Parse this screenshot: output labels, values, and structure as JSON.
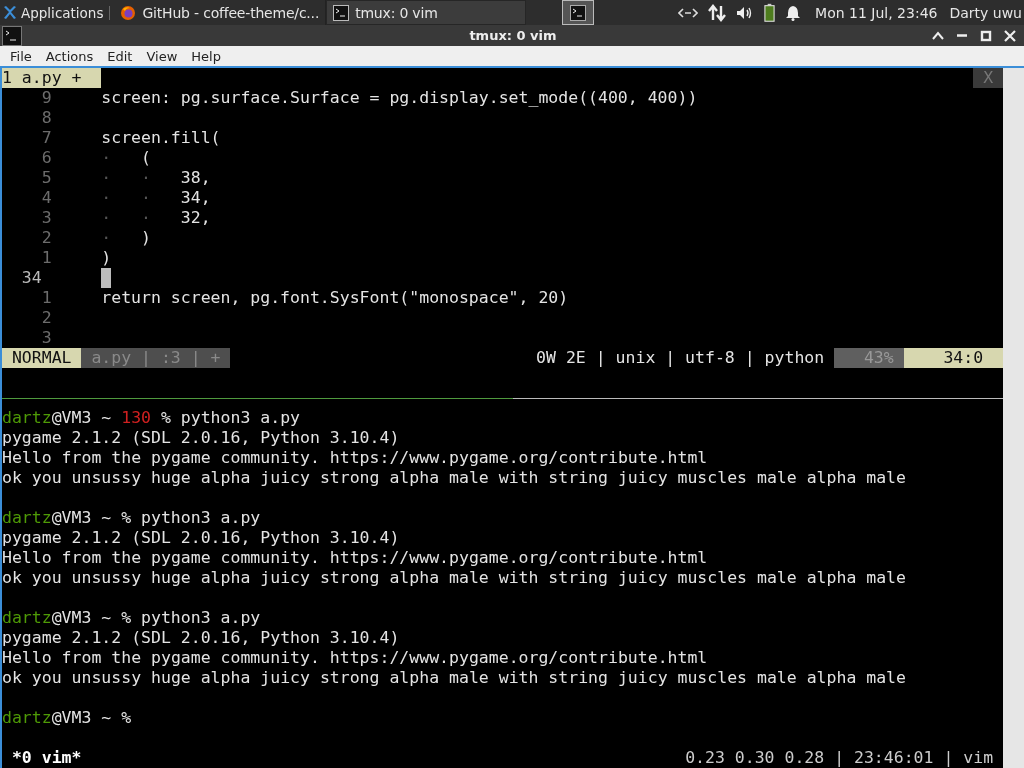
{
  "top_panel": {
    "apps_menu": "Applications",
    "tasks": [
      {
        "label": "GitHub - coffee-theme/c...",
        "kind": "browser",
        "selected": false
      },
      {
        "label": "tmux: 0 vim",
        "kind": "terminal",
        "selected": true
      }
    ],
    "clock": "Mon 11 Jul, 23:46",
    "user": "Darty uwu"
  },
  "window": {
    "title": "tmux: 0 vim",
    "menu": [
      "File",
      "Actions",
      "Edit",
      "View",
      "Help"
    ]
  },
  "vim": {
    "tab": "1 a.py +",
    "close": "X",
    "lines": [
      {
        "number": "9",
        "current": false,
        "code": "screen: pg.surface.Surface = pg.display.set_mode((400, 400))"
      },
      {
        "number": "8",
        "current": false
      },
      {
        "number": "7",
        "current": false,
        "code": "screen.fill("
      },
      {
        "number": "6",
        "current": false,
        "guides": [
          "·"
        ],
        "code": "("
      },
      {
        "number": "5",
        "current": false,
        "guides": [
          "·",
          "·"
        ],
        "code": "38,"
      },
      {
        "number": "4",
        "current": false,
        "guides": [
          "·",
          "·"
        ],
        "code": "34,"
      },
      {
        "number": "3",
        "current": false,
        "guides": [
          "·",
          "·"
        ],
        "code": "32,"
      },
      {
        "number": "2",
        "current": false,
        "guides": [
          "·"
        ],
        "code": ")"
      },
      {
        "number": "1",
        "current": false,
        "code": ")"
      },
      {
        "number": "34",
        "current": true
      },
      {
        "number": "1",
        "current": false,
        "code": "return screen, pg.font.SysFont(\"monospace\", 20)"
      },
      {
        "number": "2",
        "current": false
      },
      {
        "number": "3",
        "current": false
      }
    ],
    "status": {
      "mode": "NORMAL",
      "file_info": "a.py | :3 | +",
      "info": "0W 2E | unix | utf-8 | python",
      "percent": "43%",
      "position": "34:0"
    }
  },
  "shell": {
    "blocks": [
      {
        "user": "dartz",
        "host": "@VM3",
        "cwd": "~",
        "exit_code": "130",
        "symbol": "%",
        "command": "python3 a.py",
        "output": [
          "pygame 2.1.2 (SDL 2.0.16, Python 3.10.4)",
          "Hello from the pygame community. https://www.pygame.org/contribute.html",
          "ok you unsussy huge alpha juicy strong alpha male with string juicy muscles male alpha male"
        ]
      },
      {
        "user": "dartz",
        "host": "@VM3",
        "cwd": "~",
        "symbol": "%",
        "command": "python3 a.py",
        "output": [
          "pygame 2.1.2 (SDL 2.0.16, Python 3.10.4)",
          "Hello from the pygame community. https://www.pygame.org/contribute.html",
          "ok you unsussy huge alpha juicy strong alpha male with string juicy muscles male alpha male"
        ]
      },
      {
        "user": "dartz",
        "host": "@VM3",
        "cwd": "~",
        "symbol": "%",
        "command": "python3 a.py",
        "output": [
          "pygame 2.1.2 (SDL 2.0.16, Python 3.10.4)",
          "Hello from the pygame community. https://www.pygame.org/contribute.html",
          "ok you unsussy huge alpha juicy strong alpha male with string juicy muscles male alpha male"
        ]
      },
      {
        "user": "dartz",
        "host": "@VM3",
        "cwd": "~",
        "symbol": "%"
      }
    ]
  },
  "tmux_status": {
    "window": "*0 vim*",
    "right": "0.23 0.30 0.28 | 23:46:01 | vim"
  }
}
